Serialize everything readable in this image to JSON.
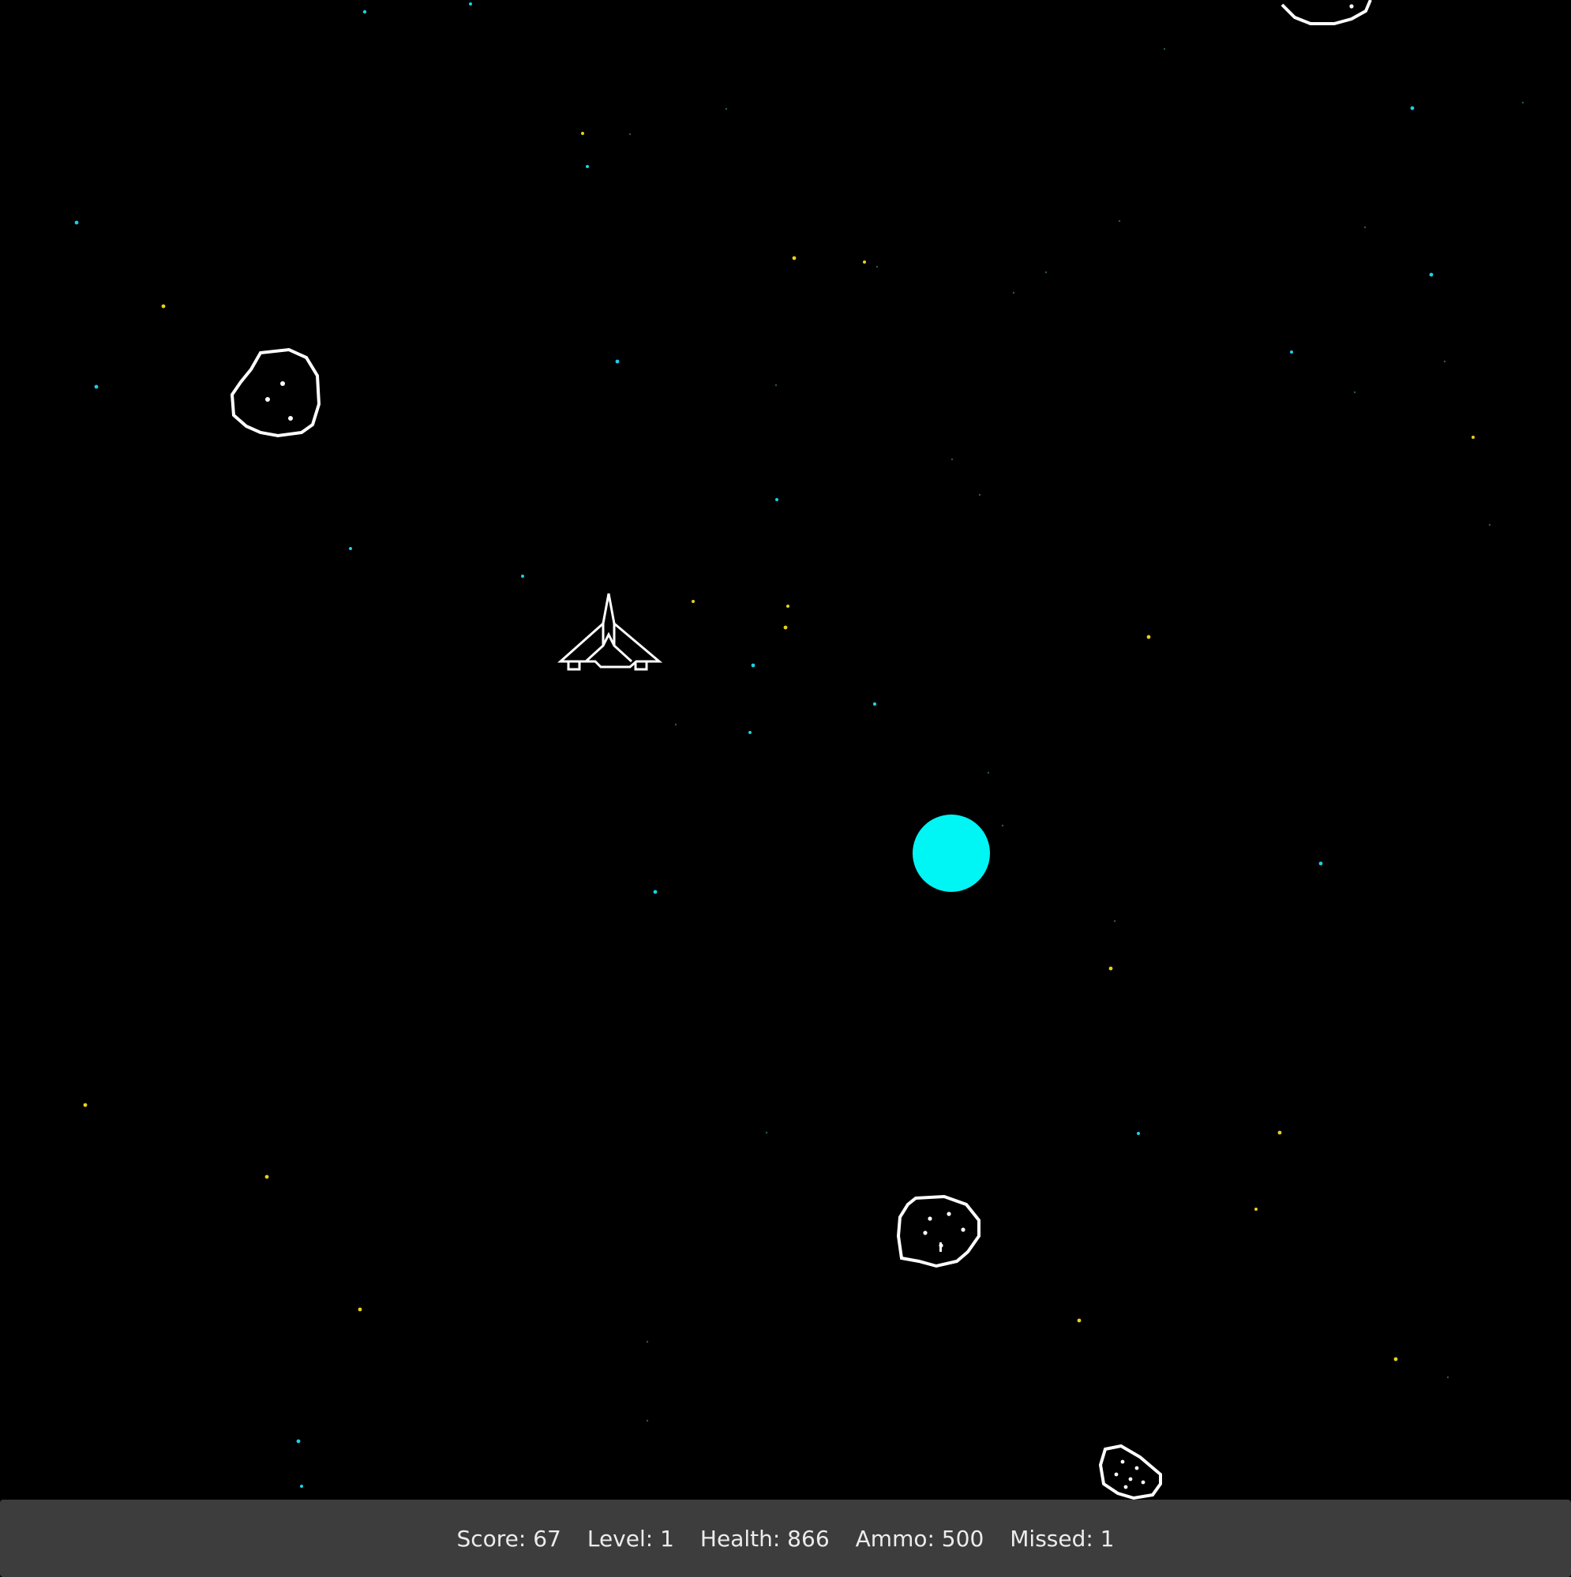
{
  "hud": {
    "score_label": "Score: 67",
    "level_label": "Level: 1",
    "health_label": "Health: 866",
    "ammo_label": "Ammo: 500",
    "missed_label": "Missed: 1"
  },
  "colors": {
    "background": "#000000",
    "hud_background": "#3d3d3d",
    "hud_text": "#ececec",
    "sprite_outline": "#ffffff",
    "orb": "#00f5f5",
    "star_cyan": "#1ad1e6",
    "star_yellow": "#e6d21a"
  },
  "sprites": {
    "player": "player-ship-icon",
    "asteroids": "asteroid-icon",
    "orb": "energy-orb"
  }
}
